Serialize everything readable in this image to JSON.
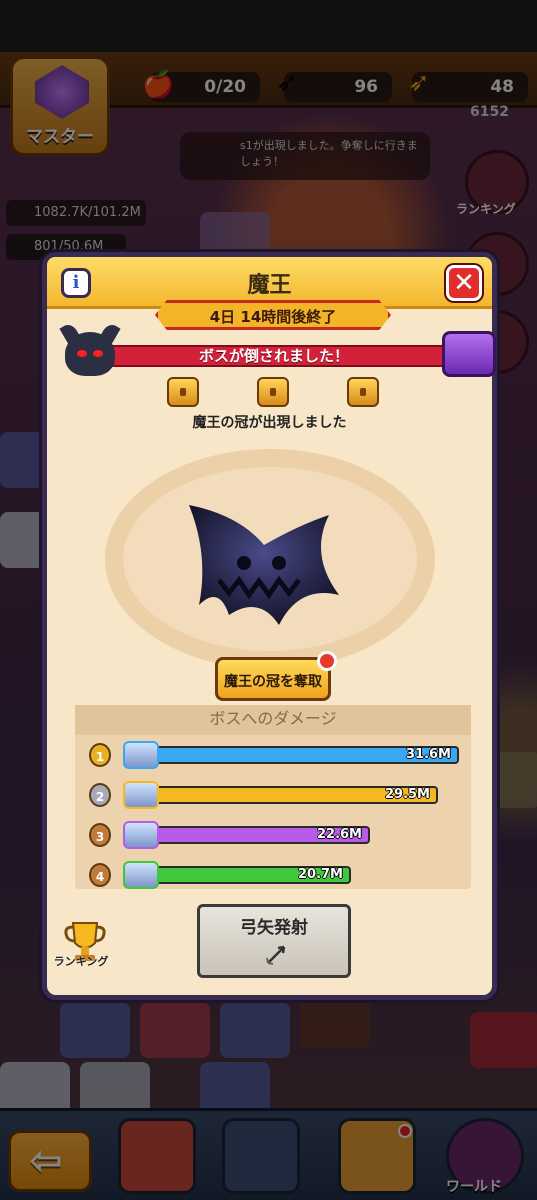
{
  "hud": {
    "master_label": "マスター",
    "stamina": "0/20",
    "arrows_silver": "96",
    "arrows_gold": "48",
    "gems": "6152",
    "notice": "s1が出現しました。争奪しに行きましょう！",
    "stat_1": "1082.7K/101.2M",
    "stat_2": "801/50.6M",
    "side_ranking": "ランキング",
    "world_label": "ワールド"
  },
  "modal": {
    "title": "魔王",
    "timer": "4日 14時間後終了",
    "boss_status": "ボスが倒されました！",
    "crown_message": "魔王の冠が出現しました",
    "steal_button": "魔王の冠を奪取",
    "damage_header": "ボスへのダメージ",
    "ranking_label": "ランキング",
    "fire_button": "弓矢発射"
  },
  "damage_ranking": [
    {
      "rank": "1",
      "value": "31.6M",
      "amount": 31.6,
      "color": "#3aa8f0",
      "medal": "#e8b020"
    },
    {
      "rank": "2",
      "value": "29.5M",
      "amount": 29.5,
      "color": "#f5b820",
      "medal": "#a8a8b8"
    },
    {
      "rank": "3",
      "value": "22.6M",
      "amount": 22.6,
      "color": "#b85ae8",
      "medal": "#c07a3a"
    },
    {
      "rank": "4",
      "value": "20.7M",
      "amount": 20.7,
      "color": "#3ec83a",
      "medal": "#c07a3a"
    }
  ],
  "icons": {
    "info": "i",
    "close": "✕",
    "back": "⇦"
  }
}
